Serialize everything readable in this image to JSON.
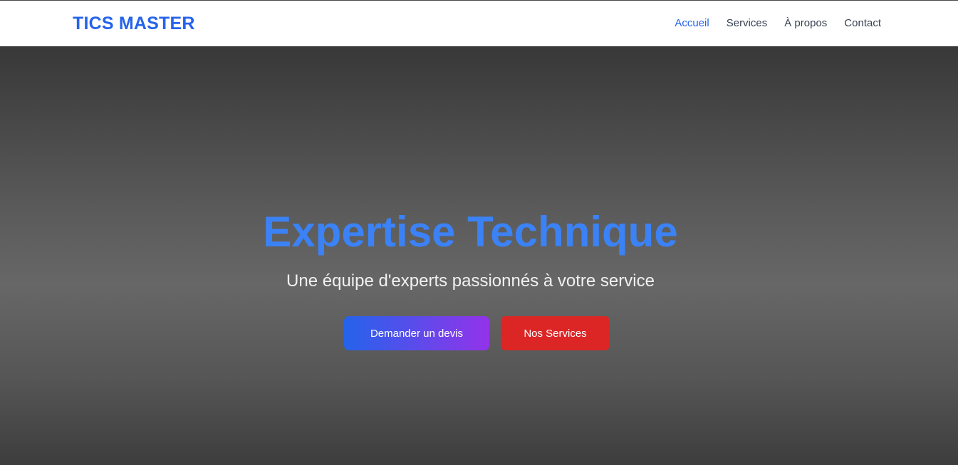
{
  "navbar": {
    "brand": "TICS MASTER",
    "links": [
      {
        "label": "Accueil",
        "active": true
      },
      {
        "label": "Services",
        "active": false
      },
      {
        "label": "À propos",
        "active": false
      },
      {
        "label": "Contact",
        "active": false
      }
    ]
  },
  "hero": {
    "title": "Expertise Technique",
    "subtitle": "Une équipe d'experts passionnés à votre service",
    "primary_button": "Demander un devis",
    "secondary_button": "Nos Services"
  },
  "colors": {
    "brand_blue": "#2563eb",
    "title_blue": "#3b82f6",
    "gradient_purple": "#9333ea",
    "button_red": "#dc2626"
  }
}
